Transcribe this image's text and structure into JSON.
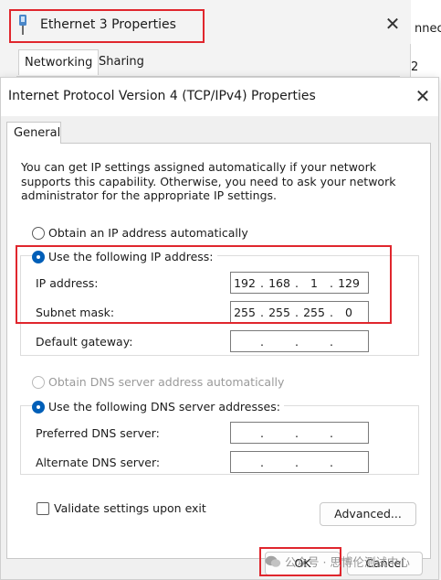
{
  "background_window": {
    "title": "Ethernet 3 Properties",
    "tabs": [
      "Networking",
      "Sharing"
    ],
    "side_text_1": "nnecti",
    "side_text_2": "2"
  },
  "dialog": {
    "title": "Internet Protocol Version 4 (TCP/IPv4) Properties",
    "tab": "General",
    "intro": "You can get IP settings assigned automatically if your network supports this capability. Otherwise, you need to ask your network administrator for the appropriate IP settings.",
    "ip_auto_label": "Obtain an IP address automatically",
    "ip_manual_label": "Use the following IP address:",
    "ip_address_label": "IP address:",
    "ip_address": [
      "192",
      "168",
      "1",
      "129"
    ],
    "subnet_mask_label": "Subnet mask:",
    "subnet_mask": [
      "255",
      "255",
      "255",
      "0"
    ],
    "gateway_label": "Default gateway:",
    "gateway": [
      "",
      "",
      "",
      ""
    ],
    "dns_auto_label": "Obtain DNS server address automatically",
    "dns_manual_label": "Use the following DNS server addresses:",
    "preferred_dns_label": "Preferred DNS server:",
    "preferred_dns": [
      "",
      "",
      "",
      ""
    ],
    "alternate_dns_label": "Alternate DNS server:",
    "alternate_dns": [
      "",
      "",
      "",
      ""
    ],
    "validate_label": "Validate settings upon exit",
    "advanced_button": "Advanced...",
    "ok_button": "OK",
    "cancel_button": "Cancel"
  },
  "watermark": {
    "text": "公众号 · 思博伦测试中心"
  },
  "colors": {
    "highlight": "#e0262d",
    "accent": "#005fb8"
  }
}
